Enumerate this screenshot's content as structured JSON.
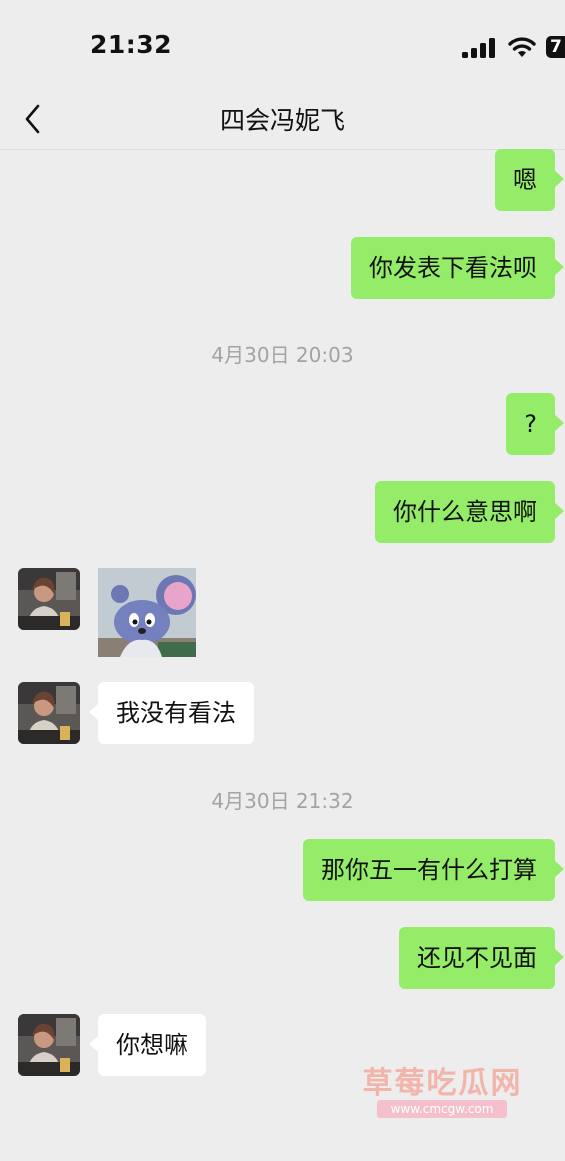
{
  "status_bar": {
    "time": "21:32",
    "battery": "7"
  },
  "header": {
    "title": "四会冯妮飞"
  },
  "messages": {
    "m1": "嗯",
    "m2": "你发表下看法呗",
    "ts1": "4月30日 20:03",
    "m3": "?",
    "m4": "你什么意思啊",
    "m6": "我没有看法",
    "ts2": "4月30日 21:32",
    "m7": "那你五一有什么打算",
    "m8": "还见不见面",
    "m9": "你想嘛"
  },
  "icons": {
    "back": "chevron-left-icon",
    "signal": "cellular-signal-icon",
    "wifi": "wifi-icon",
    "battery": "battery-icon",
    "sticker": "cartoon-mouse-sticker",
    "avatar": "contact-avatar"
  },
  "watermark": {
    "title": "草莓吃瓜网",
    "url": "www.cmcgw.com"
  },
  "colors": {
    "sent_bubble": "#95ec69",
    "received_bubble": "#ffffff",
    "background": "#ededed",
    "timestamp": "#a3a3a3"
  }
}
